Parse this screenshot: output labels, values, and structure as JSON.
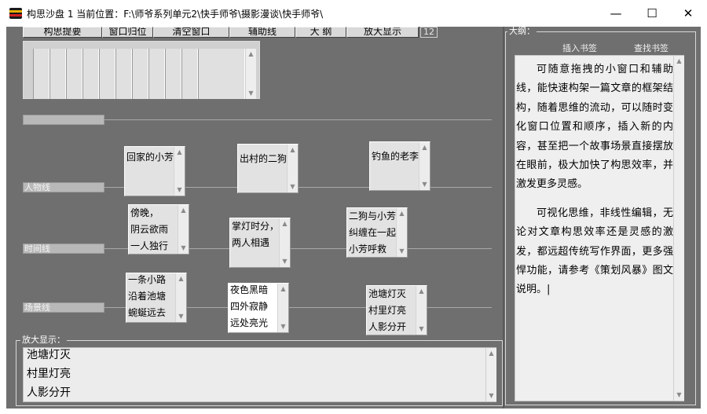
{
  "window": {
    "title": "构思沙盘 1   当前位置：F:\\师爷系列单元2\\快手师爷\\摄影漫谈\\快手师爷\\",
    "minimize_glyph": "—",
    "maximize_glyph": "☐",
    "close_glyph": "✕"
  },
  "toolbar": {
    "buttons": [
      "构思提要",
      "窗口归位",
      "清空窗口",
      "辅助线",
      "大  纲",
      "放大显示"
    ],
    "counter": "12"
  },
  "lanes": {
    "character": "人物线",
    "time": "时间线",
    "scene": "场景线"
  },
  "cards": {
    "character": [
      "回家的小芳",
      "出村的二狗",
      "钓鱼的老李"
    ],
    "time": [
      "傍晚，\n阴云欲雨\n一人独行",
      "掌灯时分，\n两人相遇",
      "二狗与小芳\n纠缠在一起\n小芳呼救"
    ],
    "scene": [
      "一条小路\n沿着池塘\n蜿蜒远去",
      "夜色黑暗\n四外寂静\n远处亮光",
      "池塘灯灭\n村里灯亮\n人影分开"
    ]
  },
  "zoom": {
    "label": "放大显示：",
    "text": "池塘灯灭\n村里灯亮\n人影分开"
  },
  "outline": {
    "label": "大纲：",
    "insert_bookmark": "插入书签",
    "find_bookmark": "查找书签",
    "paragraphs": [
      "可随意拖拽的小窗口和辅助线，能快速构架一篇文章的框架结构，随着思维的流动，可以随时变化窗口位置和顺序，插入新的内容，甚至把一个故事场景直接摆放在眼前，极大加快了构思效率，并激发更多灵感。",
      "可视化思维，非线性编辑，无论对文章构思效率还是灵感的激发，都远超传统写作界面，更多强悍功能，请参考《策划风暴》图文说明。|"
    ]
  },
  "icons": {
    "app": "app-icon",
    "scroll_up": "▲",
    "scroll_down": "▼"
  }
}
